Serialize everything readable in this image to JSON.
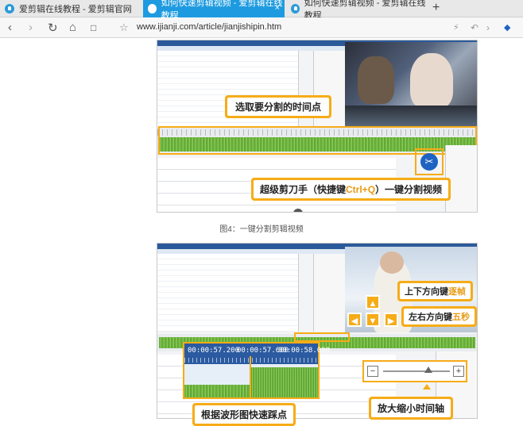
{
  "browser": {
    "tabs": [
      {
        "label": "爱剪辑在线教程 - 爱剪辑官网",
        "active": false
      },
      {
        "label": "如何快速剪辑视频 - 爱剪辑在线教程",
        "active": true
      },
      {
        "label": "如何快速剪辑视频 - 爱剪辑在线教程",
        "active": false
      }
    ],
    "close_glyph": "×",
    "new_tab_glyph": "+",
    "url": "www.ijianji.com/article/jianjishipin.htm",
    "icons": [
      "back-icon",
      "forward-icon",
      "reload-icon",
      "home-icon",
      "reader-icon",
      "star-icon",
      "lightning-icon",
      "undo-icon",
      "forward-arrow-icon",
      "paw-icon"
    ]
  },
  "figure1": {
    "callout_top": "选取要分割的时间点",
    "callout_bottom_pre": "超级剪刀手（快捷键",
    "callout_bottom_key": "Ctrl+Q",
    "callout_bottom_post": "）一键分割视频"
  },
  "figure1_caption": "图4：一键分割剪辑视频",
  "figure2": {
    "callout_updown_pre": "上下方向键",
    "callout_updown_hl": "逐帧",
    "callout_leftright_pre": "左右方向键",
    "callout_leftright_hl": "五秒",
    "timecodes": [
      "00:00:57.200",
      "00:00:57.600",
      "00:00:58.000"
    ],
    "callout_wave": "根据波形图快速踩点",
    "callout_zoom": "放大缩小时间轴",
    "zoom_minus": "−",
    "zoom_plus": "+"
  },
  "colors": {
    "accent": "#f6ac17",
    "tab_active": "#1e9be0",
    "wave": "#6cb33e"
  }
}
